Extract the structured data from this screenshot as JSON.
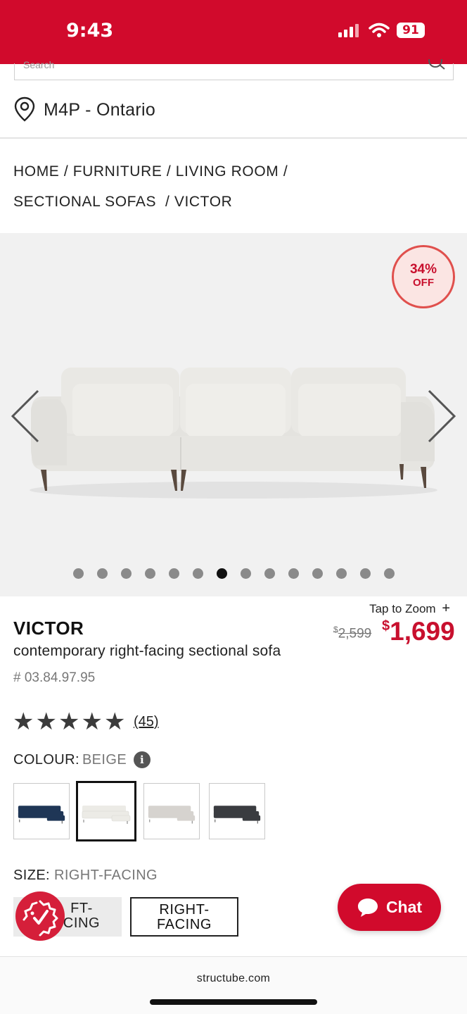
{
  "status_bar": {
    "time": "9:43",
    "battery": "91"
  },
  "search": {
    "placeholder": "Search"
  },
  "location": {
    "label": "M4P - Ontario"
  },
  "breadcrumb": {
    "items": [
      "HOME",
      "FURNITURE",
      "LIVING ROOM",
      "SECTIONAL SOFAS",
      "VICTOR"
    ],
    "separator": "/"
  },
  "gallery": {
    "badge_percent": "34%",
    "badge_off": "OFF",
    "image_count": 14,
    "active_index": 6
  },
  "product": {
    "tap_to_zoom": "Tap to Zoom",
    "zoom_plus": "+",
    "name": "VICTOR",
    "description": "contemporary right-facing sectional sofa",
    "sku": "# 03.84.97.95",
    "price_old_symbol": "$",
    "price_old_amount": "2,599",
    "price_new_symbol": "$",
    "price_new_amount": "1,699",
    "rating": 5,
    "review_count": "(45)"
  },
  "colour": {
    "label": "COLOUR:",
    "selected": "BEIGE",
    "info_glyph": "i",
    "swatches": [
      {
        "name": "navy",
        "fill": "#1f3656"
      },
      {
        "name": "beige",
        "fill": "#ecebe6"
      },
      {
        "name": "light-grey",
        "fill": "#d6d3cf"
      },
      {
        "name": "charcoal",
        "fill": "#3a3c40"
      }
    ]
  },
  "size": {
    "label": "SIZE:",
    "selected": "RIGHT-FACING",
    "options": [
      {
        "line1": "FT-",
        "line2": "CING"
      },
      {
        "line1": "RIGHT-",
        "line2": "FACING"
      }
    ]
  },
  "chat": {
    "label": "Chat"
  },
  "browser": {
    "url": "structube.com"
  },
  "colors": {
    "brand_red": "#d10a2c",
    "price_red": "#c8102e"
  }
}
